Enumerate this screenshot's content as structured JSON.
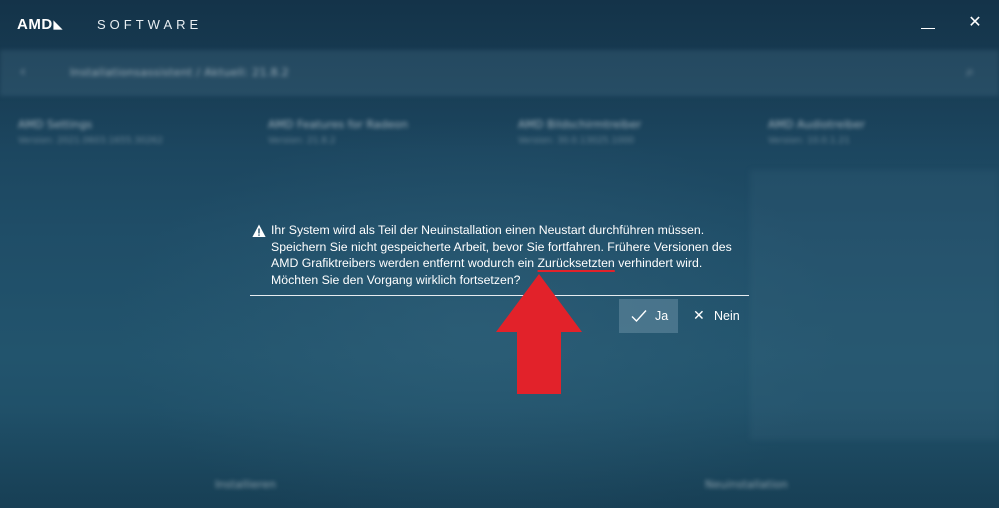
{
  "titlebar": {
    "logo": "AMD",
    "logo_mark": "◣",
    "app_name": "SOFTWARE",
    "close_glyph": "✕"
  },
  "navbar": {
    "back_glyph": "‹",
    "path": "Installationsassistent / Aktuell: 21.8.2",
    "search_glyph": "⌕"
  },
  "cards": [
    {
      "title": "AMD Settings",
      "subtitle": "Version: 2021.0603.1655.30262"
    },
    {
      "title": "AMD Features for Radeon",
      "subtitle": "Version: 21.8.2"
    },
    {
      "title": "AMD Bildschirmtreiber",
      "subtitle": "Version: 30.0.13025.1000"
    },
    {
      "title": "AMD Audiotreiber",
      "subtitle": "Version: 10.0.1.21"
    }
  ],
  "footer": {
    "left": "Installieren",
    "right": "Neuinstallation"
  },
  "dialog": {
    "message_before": "Ihr System wird als Teil der Neuinstallation einen Neustart durchführen müssen. Speichern Sie nicht gespeicherte Arbeit, bevor Sie fortfahren. Frühere Versionen des AMD Grafiktreibers werden entfernt wodurch ein ",
    "message_highlight": "Zurücksetzten",
    "message_after": " verhindert wird. Möchten Sie den Vorgang wirklich fortsetzen?",
    "yes_label": "Ja",
    "no_label": "Nein",
    "no_glyph": "✕"
  },
  "colors": {
    "background": "#1f4d67",
    "annotation": "#e2222a",
    "yes_button": "#5f7f93"
  },
  "icons": {
    "warning": "warning-triangle-icon",
    "yes": "checkmark-icon",
    "no": "close-icon",
    "annotation": "red-up-arrow"
  }
}
